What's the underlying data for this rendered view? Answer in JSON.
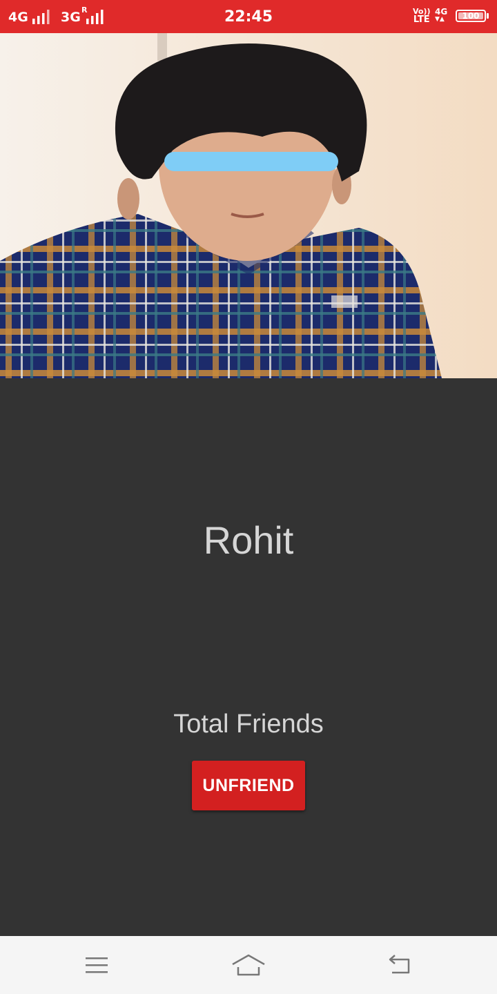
{
  "status_bar": {
    "network_1": "4G",
    "network_2": "3G",
    "roaming": "R",
    "time": "22:45",
    "volte_line1": "Vo))",
    "volte_line2": "LTE",
    "data_type": "4G",
    "battery": "100",
    "background_color": "#E02A2A"
  },
  "profile": {
    "photo_icon": "profile-photo",
    "name": "Rohit",
    "total_friends_label": "Total Friends",
    "unfriend_label": "UNFRIEND",
    "button_color": "#D32020"
  },
  "nav_bar": {
    "menu_icon": "menu-icon",
    "home_icon": "home-icon",
    "back_icon": "back-icon"
  }
}
